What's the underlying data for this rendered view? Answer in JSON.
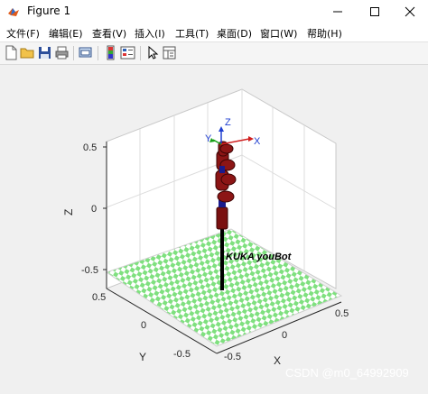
{
  "window": {
    "title": "Figure 1",
    "minimize_icon": "minimize-icon",
    "maximize_icon": "maximize-icon",
    "close_icon": "close-icon"
  },
  "menu": {
    "items": [
      "文件(F)",
      "编辑(E)",
      "查看(V)",
      "插入(I)",
      "工具(T)",
      "桌面(D)",
      "窗口(W)",
      "帮助(H)"
    ]
  },
  "toolbar": {
    "icons": [
      "new-figure-icon",
      "open-file-icon",
      "save-icon",
      "print-icon",
      "link-plot-icon",
      "insert-colorbar-icon",
      "insert-legend-icon",
      "edit-plot-icon",
      "property-inspector-icon"
    ]
  },
  "plot": {
    "zlabel": "Z",
    "ylabel": "Y",
    "xlabel": "X",
    "z_ticks": [
      "0.5",
      "0",
      "-0.5"
    ],
    "y_ticks": [
      "0.5",
      "0",
      "-0.5"
    ],
    "x_ticks": [
      "-0.5",
      "0",
      "0.5"
    ],
    "robot_label": "KUKA youBot",
    "frame_labels": {
      "z": "Z",
      "x": "X",
      "y": "Y"
    },
    "colors": {
      "floor_green": "#7fe07f",
      "floor_white": "#ffffff",
      "link_red": "#7a1010",
      "joint_blue": "#1a1a8c",
      "post": "#000000"
    }
  },
  "watermark": "CSDN @m0_64992909"
}
